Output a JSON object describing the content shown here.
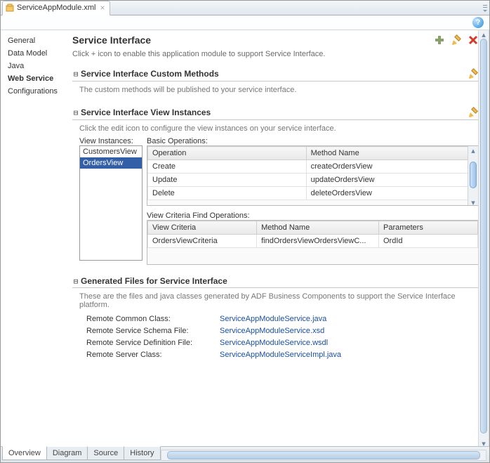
{
  "tab": {
    "filename": "ServiceAppModule.xml"
  },
  "sidebar": {
    "items": [
      {
        "label": "General"
      },
      {
        "label": "Data Model"
      },
      {
        "label": "Java"
      },
      {
        "label": "Web Service"
      },
      {
        "label": "Configurations"
      }
    ],
    "active_index": 3
  },
  "main": {
    "title": "Service Interface",
    "subtitle": "Click + icon to enable this application module to support Service Interface.",
    "sections": {
      "custom": {
        "title": "Service Interface Custom Methods",
        "desc": "The custom methods will be published to your service interface."
      },
      "views": {
        "title": "Service Interface View Instances",
        "desc": "Click the edit icon to configure the view instances on your service interface.",
        "list_label": "View Instances:",
        "list_items": [
          "CustomersView",
          "OrdersView"
        ],
        "list_selected": 1,
        "basic_label": "Basic Operations:",
        "basic_cols": [
          "Operation",
          "Method Name"
        ],
        "basic_rows": [
          {
            "op": "Create",
            "method": "createOrdersView"
          },
          {
            "op": "Update",
            "method": "updateOrdersView"
          },
          {
            "op": "Delete",
            "method": "deleteOrdersView"
          }
        ],
        "crit_label": "View Criteria Find Operations:",
        "crit_cols": [
          "View Criteria",
          "Method Name",
          "Parameters"
        ],
        "crit_rows": [
          {
            "vc": "OrdersViewCriteria",
            "method": "findOrdersViewOrdersViewC...",
            "params": "OrdId"
          }
        ]
      },
      "files": {
        "title": "Generated Files for Service Interface",
        "desc": "These are the files and java classes generated by ADF Business Components to support the Service Interface platform.",
        "rows": [
          {
            "label": "Remote Common Class:",
            "value": "ServiceAppModuleService.java"
          },
          {
            "label": "Remote Service Schema File:",
            "value": "ServiceAppModuleService.xsd"
          },
          {
            "label": "Remote Service Definition File:",
            "value": "ServiceAppModuleService.wsdl"
          },
          {
            "label": "Remote Server Class:",
            "value": "ServiceAppModuleServiceImpl.java"
          }
        ]
      }
    }
  },
  "bottom_tabs": [
    "Overview",
    "Diagram",
    "Source",
    "History"
  ],
  "bottom_active": 0
}
